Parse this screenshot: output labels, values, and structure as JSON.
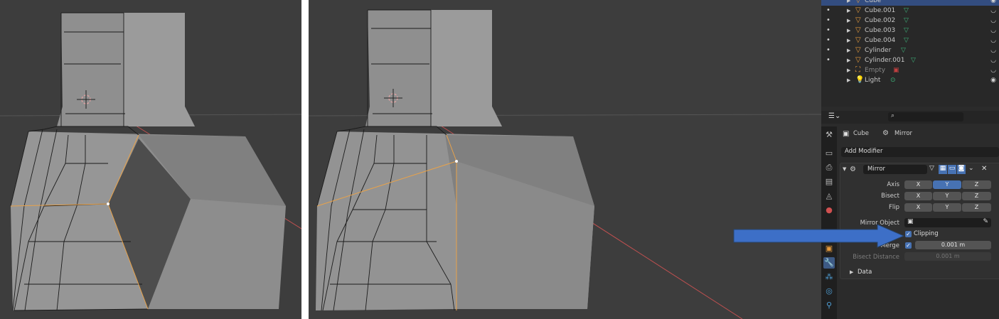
{
  "outliner": {
    "rows": [
      {
        "label": "Cube",
        "icon": "mesh-triangle-icon",
        "color": "#e69a3c"
      },
      {
        "label": "Cube.001",
        "icon": "mesh-triangle-icon",
        "color": "#e69a3c"
      },
      {
        "label": "Cube.002",
        "icon": "mesh-triangle-icon",
        "color": "#e69a3c"
      },
      {
        "label": "Cube.003",
        "icon": "mesh-triangle-icon",
        "color": "#e69a3c"
      },
      {
        "label": "Cube.004",
        "icon": "mesh-triangle-icon",
        "color": "#e69a3c"
      },
      {
        "label": "Cylinder",
        "icon": "mesh-triangle-icon",
        "color": "#e69a3c"
      },
      {
        "label": "Cylinder.001",
        "icon": "mesh-triangle-icon",
        "color": "#e69a3c"
      },
      {
        "label": "Empty",
        "icon": "empty-icon",
        "color": "#e69a3c"
      },
      {
        "label": "Light",
        "icon": "light-bulb-icon",
        "color": "#e69a3c"
      }
    ]
  },
  "properties": {
    "breadcrumb_object": "Cube",
    "breadcrumb_modifier": "Mirror",
    "add_modifier": "Add Modifier",
    "modifier_name": "Mirror",
    "axis_label": "Axis",
    "bisect_label": "Bisect",
    "flip_label": "Flip",
    "x": "X",
    "y": "Y",
    "z": "Z",
    "mirror_object_label": "Mirror Object",
    "clipping_label": "Clipping",
    "merge_label": "Merge",
    "merge_value": "0.001 m",
    "bisect_distance_label": "Bisect Distance",
    "bisect_distance_value": "0.001 m",
    "data_label": "Data"
  },
  "colors": {
    "accent": "#4772b3",
    "annotation_arrow": "#3d6fc7",
    "edge_selected": "#e8a24a"
  }
}
